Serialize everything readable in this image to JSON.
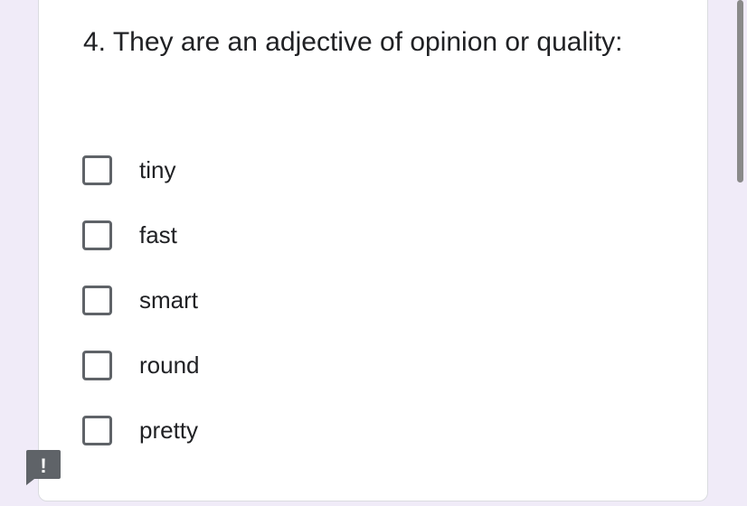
{
  "question": {
    "title": "4. They are an adjective of opinion or quality:"
  },
  "options": [
    {
      "label": "tiny",
      "checked": false
    },
    {
      "label": "fast",
      "checked": false
    },
    {
      "label": "smart",
      "checked": false
    },
    {
      "label": "round",
      "checked": false
    },
    {
      "label": "pretty",
      "checked": false
    }
  ],
  "report_button": {
    "icon": "report-problem-icon",
    "glyph": "!"
  },
  "colors": {
    "page_background": "#f0ebf8",
    "card_background": "#ffffff",
    "checkbox_border": "#5f6368",
    "text": "#202124",
    "report_button": "#5f6368"
  }
}
